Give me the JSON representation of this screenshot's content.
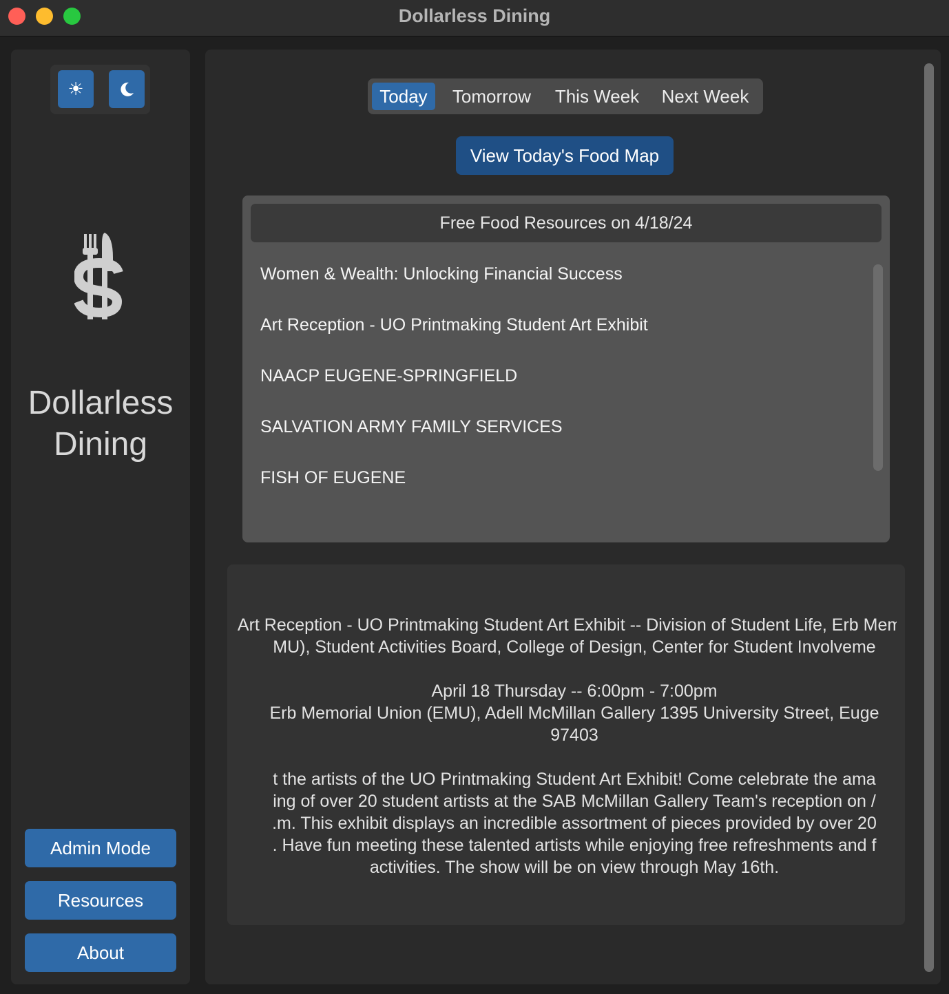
{
  "window": {
    "title": "Dollarless Dining"
  },
  "sidebar": {
    "theme_light_icon": "sun-icon",
    "theme_dark_icon": "moon-icon",
    "logo_icon": "fork-knife-dollar-icon",
    "app_name_line1": "Dollarless",
    "app_name_line2": "Dining",
    "buttons": [
      "Admin Mode",
      "Resources",
      "About"
    ]
  },
  "tabs": {
    "items": [
      "Today",
      "Tomorrow",
      "This Week",
      "Next Week"
    ],
    "selected": "Today"
  },
  "map_button": "View Today's Food Map",
  "resources": {
    "header": "Free Food Resources on 4/18/24",
    "items": [
      "Women & Wealth: Unlocking Financial Success",
      "Art Reception - UO Printmaking Student Art Exhibit",
      "NAACP EUGENE-SPRINGFIELD",
      "SALVATION ARMY FAMILY SERVICES",
      "FISH OF EUGENE"
    ]
  },
  "detail": {
    "title_line1": "Art Reception - UO Printmaking Student Art Exhibit -- Division of Student Life, Erb Memo",
    "title_line2": "MU), Student Activities Board, College of Design, Center for Student Involveme",
    "time": "April 18 Thursday -- 6:00pm - 7:00pm",
    "location_line1": "Erb Memorial Union (EMU), Adell McMillan Gallery 1395 University Street, Euge",
    "location_line2": "97403",
    "desc_line1": "t the artists of the UO Printmaking Student Art Exhibit! Come celebrate the ama",
    "desc_line2": "ing of over 20 student artists at the SAB McMillan Gallery Team's reception on /",
    "desc_line3": ".m. This exhibit displays an incredible assortment of pieces provided by over 20",
    "desc_line4": ". Have fun meeting these talented artists while enjoying free refreshments and f",
    "desc_line5": "activities. The show will be on view through May 16th."
  },
  "colors": {
    "accent": "#2f6aa8",
    "map_button": "#1f4f85",
    "background": "#1f1f1f",
    "panel": "#2a2a2a"
  }
}
